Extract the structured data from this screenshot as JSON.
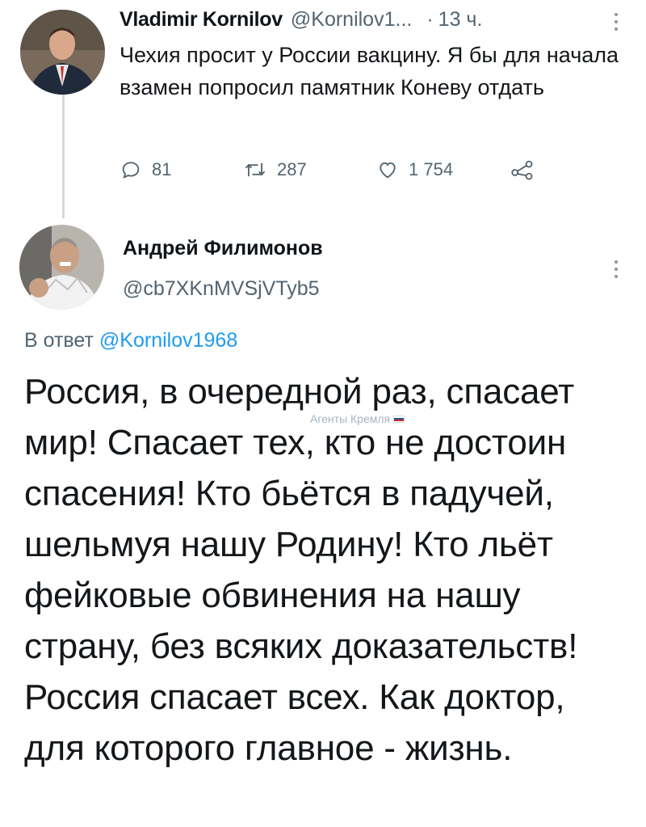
{
  "tweet1": {
    "name": "Vladimir Kornilov",
    "handle": "@Kornilov1...",
    "dot": "·",
    "time": "13 ч.",
    "text": "Чехия просит у России вакцину. Я бы для начала взамен попросил памятник Коневу отдать",
    "actions": {
      "replies": "81",
      "retweets": "287",
      "likes": "1 754"
    }
  },
  "tweet2": {
    "name": "Андрей Филимонов",
    "handle": "@cb7XKnMVSjVTyb5",
    "reply_prefix": "В ответ ",
    "reply_mention": "@Kornilov1968",
    "text": "Россия, в очередной раз, спасает мир! Спасает тех, кто не достоин спасения! Кто бьётся в падучей, шельмуя нашу Родину! Кто льёт фейковые обвинения на нашу страну, без всяких доказательств! Россия спасает всех. Как доктор, для которого главное - жизнь."
  },
  "watermark": {
    "text": "Агенты Кремля"
  },
  "colors": {
    "accent": "#1d9bf0",
    "muted": "#536471",
    "thread_line": "#cfd9de"
  },
  "icons": [
    "reply-icon",
    "retweet-icon",
    "like-icon",
    "share-icon",
    "more-icon"
  ]
}
